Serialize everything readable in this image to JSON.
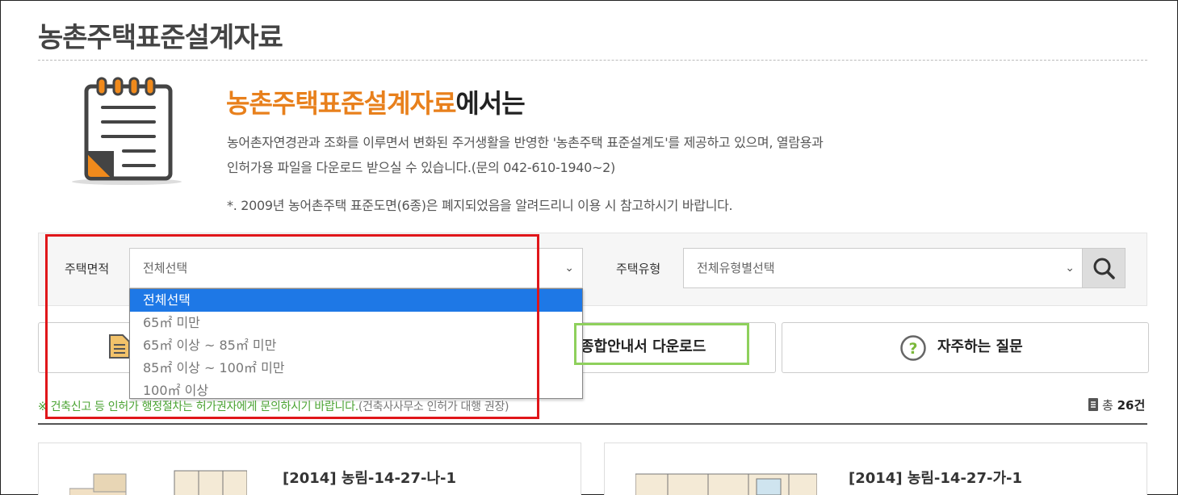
{
  "page": {
    "title": "농촌주택표준설계자료"
  },
  "intro": {
    "heading_accent": "농촌주택표준설계자료",
    "heading_rest": "에서는",
    "line1": "농어촌자연경관과 조화를 이루면서 변화된 주거생활을 반영한 '농촌주택 표준설계도'를 제공하고 있으며, 열람용과",
    "line2": "인허가용 파일을 다운로드 받으실 수 있습니다.(문의 042-610-1940~2)",
    "note": "*. 2009년 농어촌주택 표준도면(6종)은 폐지되었음을 알려드리니 이용 시 참고하시기 바랍니다."
  },
  "filters": {
    "area_label": "주택면적",
    "area_selected": "전체선택",
    "area_options": [
      "전체선택",
      "65㎡ 미만",
      "65㎡ 이상 ~ 85㎡ 미만",
      "85㎡ 이상 ~ 100㎡ 미만",
      "100㎡ 이상"
    ],
    "type_label": "주택유형",
    "type_selected": "전체유형별선택"
  },
  "actions": {
    "guide_download": "종합안내서 다운로드",
    "faq": "자주하는 질문"
  },
  "notice": {
    "green": "※ 건축신고 등 인허가 행정절차는 허가권자에게 문의하시기 바랍니다.",
    "gray": "(건축사사무소 인허가 대행 권장)"
  },
  "list": {
    "total_prefix": "총",
    "total_count": "26건"
  },
  "cards": [
    {
      "title": "[2014] 농림-14-27-나-1"
    },
    {
      "title": "[2014] 농림-14-27-가-1"
    }
  ],
  "colors": {
    "accent": "#e8801c",
    "highlight_red": "#e0161a",
    "highlight_green": "#8ed05c",
    "option_selected": "#1e78e6"
  }
}
